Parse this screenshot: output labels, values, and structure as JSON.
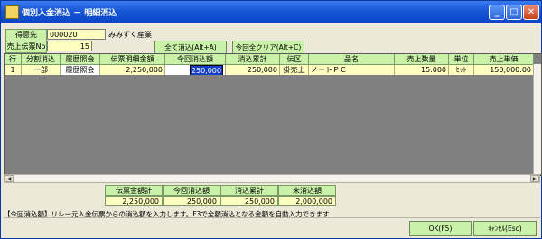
{
  "window": {
    "title": "個別入金消込 － 明細消込",
    "minimize": "_",
    "maximize": "□",
    "close": "✕"
  },
  "header": {
    "customer_label": "得意先",
    "customer_code": "000020",
    "customer_name": "みみずく産業",
    "slip_label": "売上伝票No",
    "slip_no": "15",
    "all_clear_button": "全て消込(Alt+A)",
    "this_clear_button": "今回全クリア(Alt+C)"
  },
  "table": {
    "columns": [
      "行No",
      "分割消込",
      "履歴照会",
      "伝票明細金額",
      "今回消込額",
      "消込累計",
      "伝区",
      "品名",
      "売上数量",
      "単位",
      "売上単価"
    ],
    "rows": [
      [
        "1",
        "一部",
        "履歴照会",
        "2,250,000",
        "250,000",
        "250,000",
        "掛売上",
        "ノートＰＣ",
        "15.000",
        "ｾｯﾄ",
        "150,000.00"
      ]
    ]
  },
  "scroll": {
    "left_arrow": "◀",
    "right_arrow": "▶"
  },
  "summary": {
    "headers": [
      "伝票金額計",
      "今回消込額",
      "消込累計",
      "未消込額"
    ],
    "values": [
      "2,250,000",
      "250,000",
      "250,000",
      "2,000,000"
    ]
  },
  "status_text": "【今回消込額】リレー元入金伝票からの消込額を入力します。F3で全額消込となる金額を自動入力できます",
  "footer": {
    "ok_button": "OK(F5)",
    "cancel_button": "ｷｬﾝｾﾙ(Esc)"
  }
}
